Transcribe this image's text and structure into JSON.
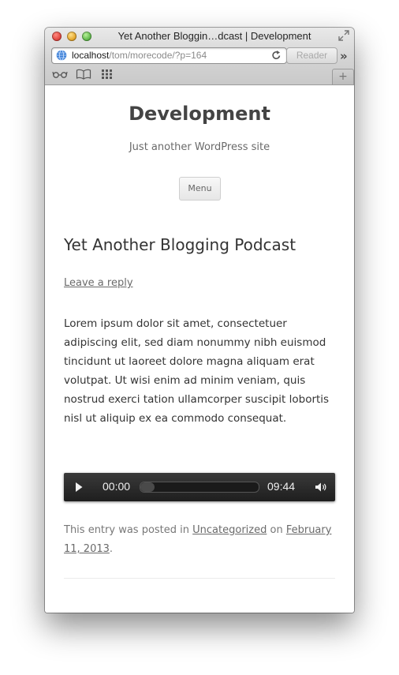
{
  "window": {
    "title": "Yet Another Bloggin…dcast | Development"
  },
  "toolbar": {
    "url_host": "localhost",
    "url_path": "/tom/morecode/?p=164",
    "reader_label": "Reader",
    "overflow_glyph": "»",
    "new_tab_glyph": "+"
  },
  "site": {
    "title": "Development",
    "description": "Just another WordPress site",
    "menu_label": "Menu"
  },
  "post": {
    "title": "Yet Another Blogging Podcast",
    "reply_link": "Leave a reply",
    "body": "Lorem ipsum dolor sit amet, consectetuer adipiscing elit, sed diam nonummy nibh euismod tincidunt ut laoreet dolore magna aliquam erat volutpat. Ut wisi enim ad minim veniam, quis nostrud exerci tation ullamcorper suscipit lobortis nisl ut aliquip ex ea commodo consequat."
  },
  "audio": {
    "current_time": "00:00",
    "duration": "09:44",
    "progress_fraction": 0.12
  },
  "meta": {
    "prefix": "This entry was posted in ",
    "category": "Uncategorized",
    "middle": " on ",
    "date": "February 11, 2013",
    "suffix": "."
  },
  "icons": [
    "fullscreen-icon",
    "globe-icon",
    "reload-icon",
    "reading-list-icon",
    "bookmarks-icon",
    "top-sites-icon",
    "play-icon",
    "volume-icon"
  ]
}
